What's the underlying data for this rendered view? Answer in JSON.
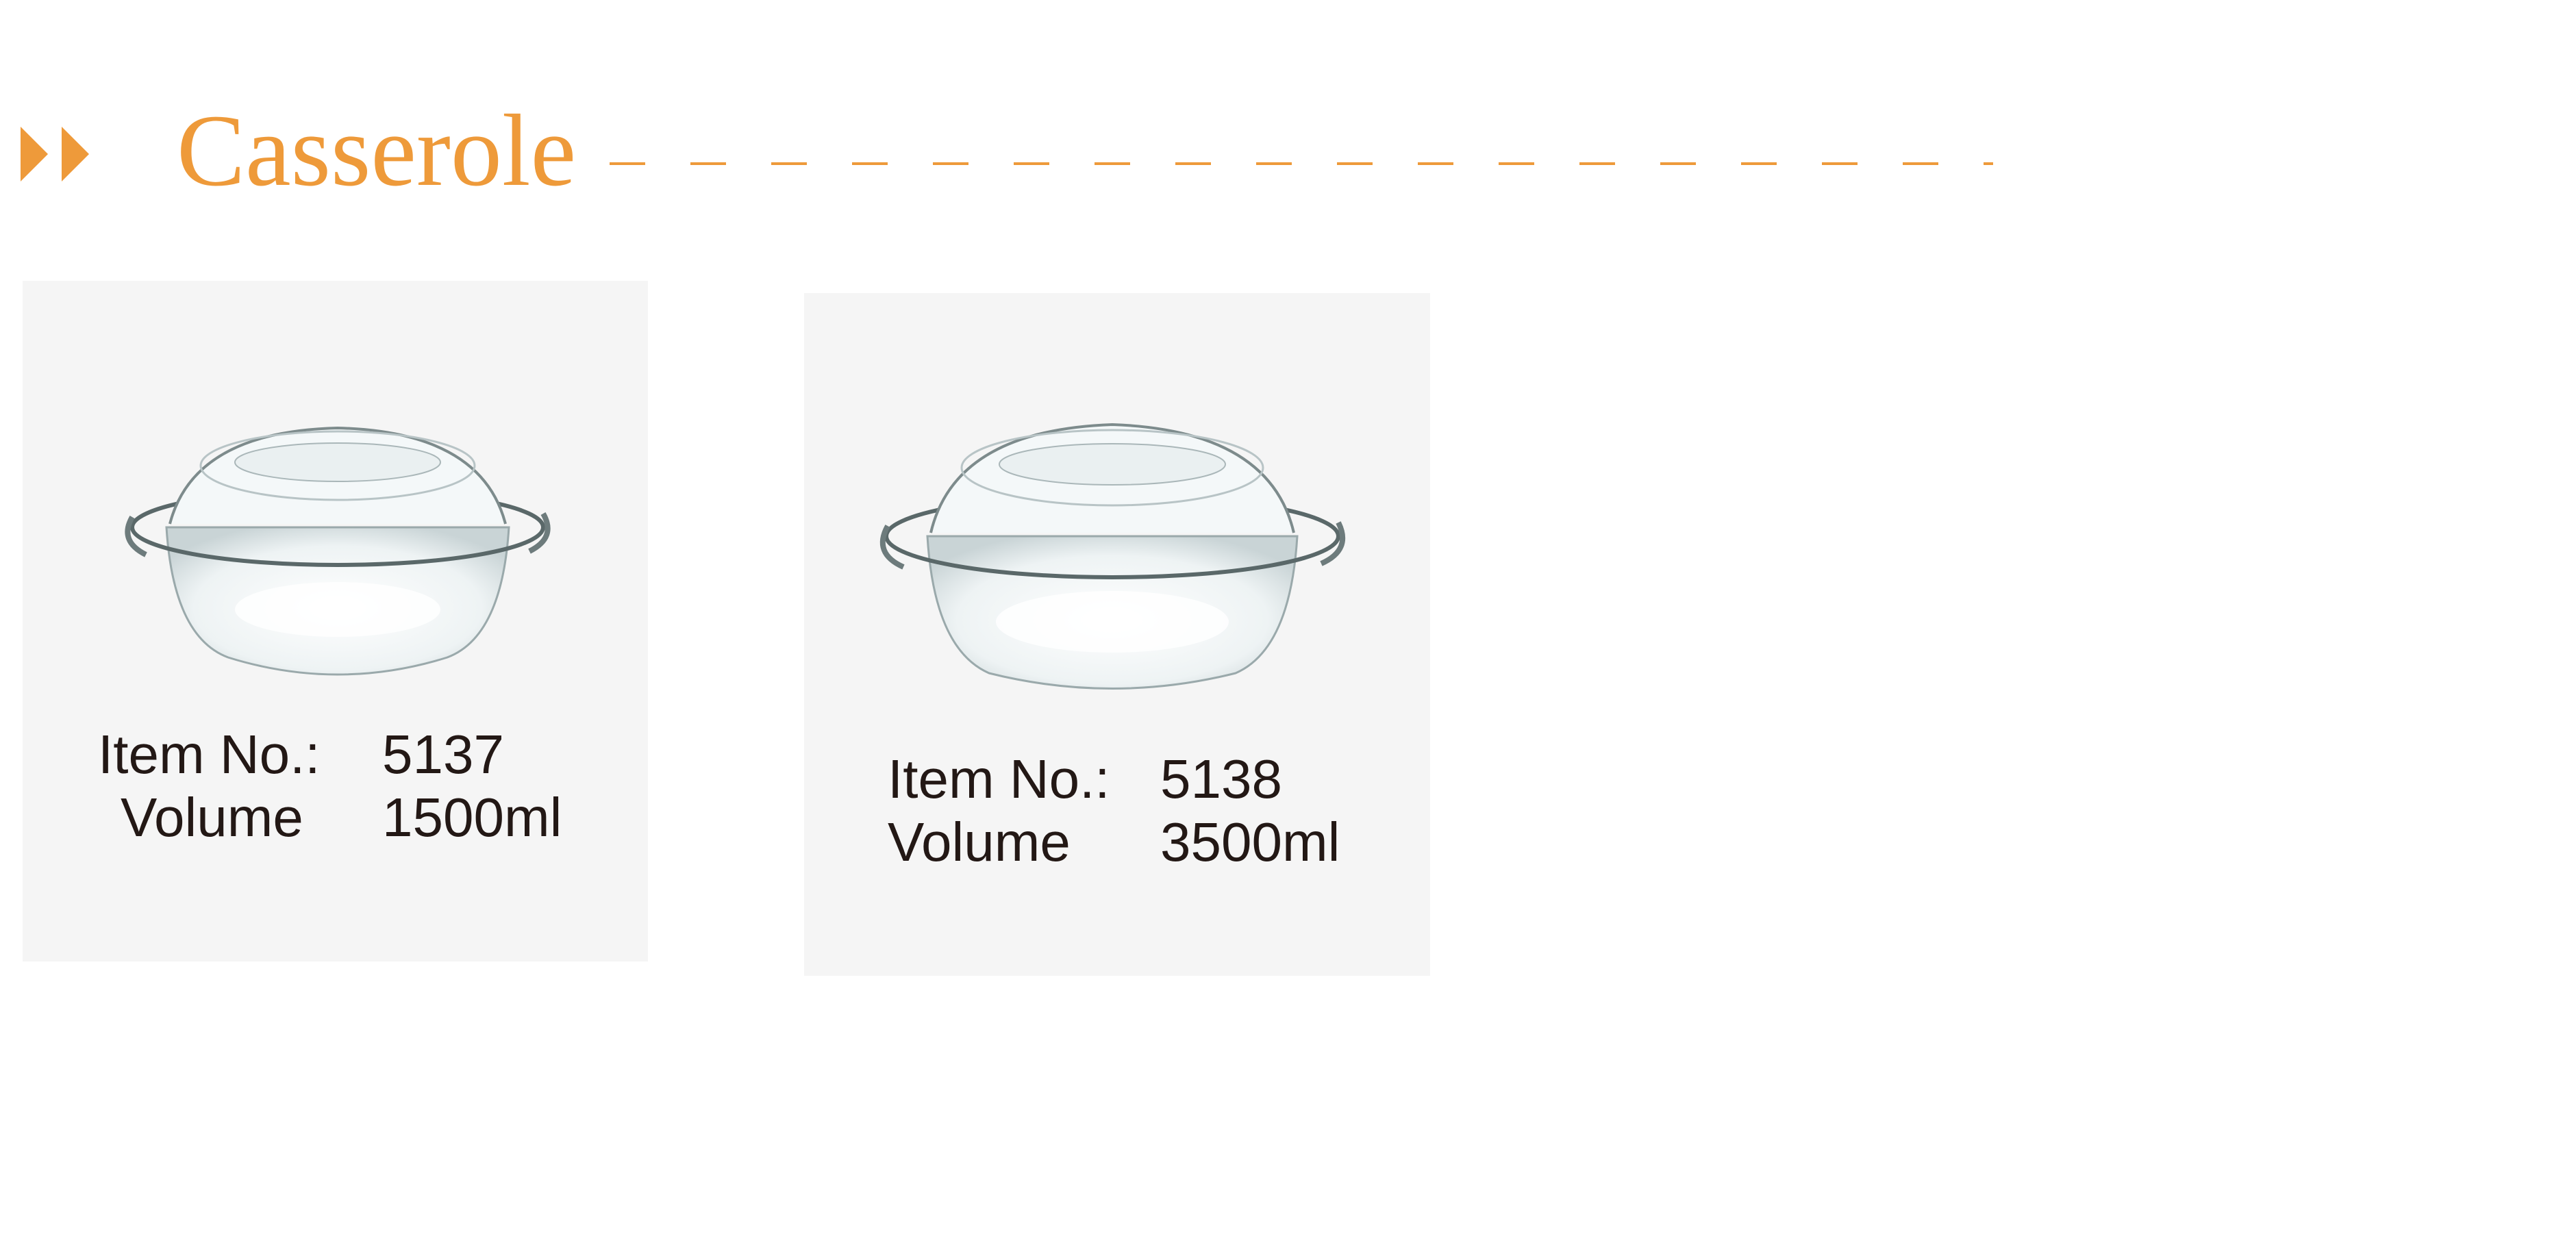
{
  "colors": {
    "accent": "#ee9a3a",
    "card_background": "#f5f5f5",
    "text": "#231815"
  },
  "header": {
    "title": "Casserole",
    "arrow_icon": "double-triangle-right-icon"
  },
  "products": [
    {
      "item_label": "Item No.:",
      "item_no": "5137",
      "volume_label": "Volume",
      "volume": "1500ml",
      "image": "glass-casserole-with-lid-icon"
    },
    {
      "item_label": "Item No.:",
      "item_no": "5138",
      "volume_label": "Volume",
      "volume": "3500ml",
      "image": "glass-casserole-with-lid-icon"
    }
  ]
}
